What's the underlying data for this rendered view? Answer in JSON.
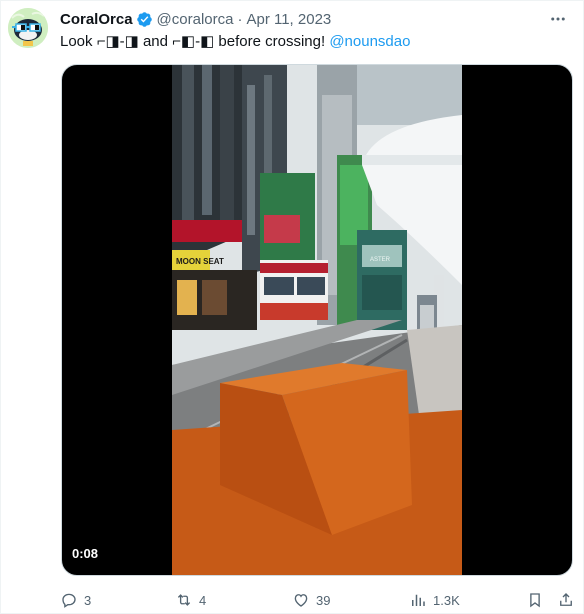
{
  "tweet": {
    "display_name": "CoralOrca",
    "handle": "@coralorca",
    "separator": "·",
    "date": "Apr 11, 2023",
    "text_prefix": "Look ⌐◨-◨ and ⌐◧-◧ before crossing! ",
    "mention": "@nounsdao",
    "media": {
      "duration": "0:08",
      "storefront_sign": "MOON SEAT",
      "tram_sign": "ASTER"
    },
    "actions": {
      "reply_count": "3",
      "retweet_count": "4",
      "like_count": "39",
      "views_count": "1.3K"
    }
  },
  "icons": {
    "verified": "verified-badge-icon",
    "more": "more-dots-icon",
    "reply": "reply-icon",
    "retweet": "retweet-icon",
    "like": "heart-icon",
    "views": "views-icon",
    "bookmark": "bookmark-icon",
    "share": "share-icon"
  },
  "colors": {
    "accent": "#1d9bf0",
    "secondary_text": "#536471",
    "noggle_orange": "#d6661a"
  }
}
